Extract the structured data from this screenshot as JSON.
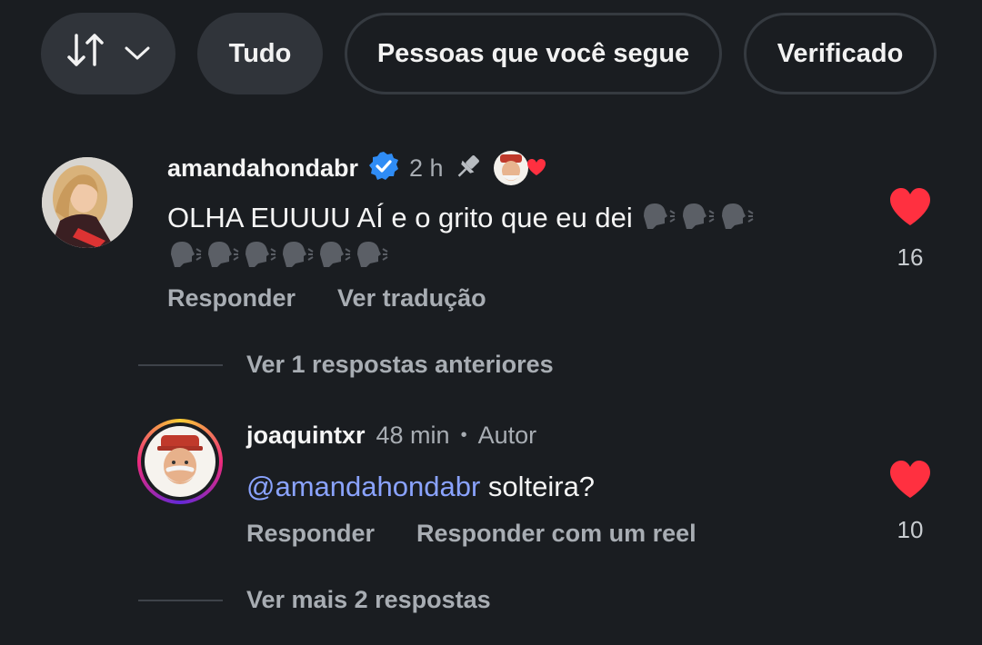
{
  "filters": {
    "sort_icon": "sort-arrows-icon",
    "chevron_icon": "chevron-down-icon",
    "tudo": "Tudo",
    "seguindo": "Pessoas que você segue",
    "verificado": "Verificado"
  },
  "comment": {
    "username": "amandahondabr",
    "time": "2 h",
    "text_line1": "OLHA EUUUU AÍ e o grito que eu dei",
    "likes": "16",
    "reply_label": "Responder",
    "translate_label": "Ver tradução",
    "verified_color": "#2f8cf5"
  },
  "view_previous": "Ver 1 respostas anteriores",
  "reply": {
    "username": "joaquintxr",
    "time": "48 min",
    "separator": "•",
    "author_tag": "Autor",
    "mention": "@amandahondabr",
    "text": " solteira?",
    "likes": "10",
    "reply_label": "Responder",
    "reel_label": "Responder com um reel"
  },
  "view_more": "Ver mais 2 respostas",
  "colors": {
    "heart": "#ff3040",
    "background": "#1a1d21",
    "mention": "#8aa3ff"
  }
}
